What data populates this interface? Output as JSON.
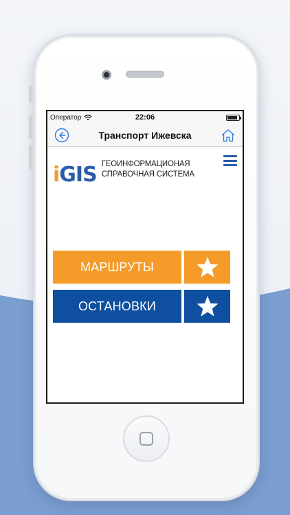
{
  "status_bar": {
    "carrier": "Оператор",
    "time": "22:06",
    "battery_level": 0.9
  },
  "nav_bar": {
    "title": "Транспорт Ижевска",
    "back_icon": "back-circle-arrow",
    "home_icon": "house"
  },
  "brand": {
    "logo_text_i": "i",
    "logo_text_gis": "GIS",
    "tagline_line1": "ГЕОИНФОРМАЦИОНАЯ",
    "tagline_line2": "СПРАВОЧНАЯ СИСТЕМА",
    "logo_orange": "#f29a2e",
    "logo_blue": "#2a5ca8"
  },
  "menu": {
    "items": [
      {
        "label": "МАРШРУТЫ",
        "color": "#f49b2a",
        "favorite_icon": "star"
      },
      {
        "label": "ОСТАНОВКИ",
        "color": "#0e4f9f",
        "favorite_icon": "star"
      }
    ]
  }
}
